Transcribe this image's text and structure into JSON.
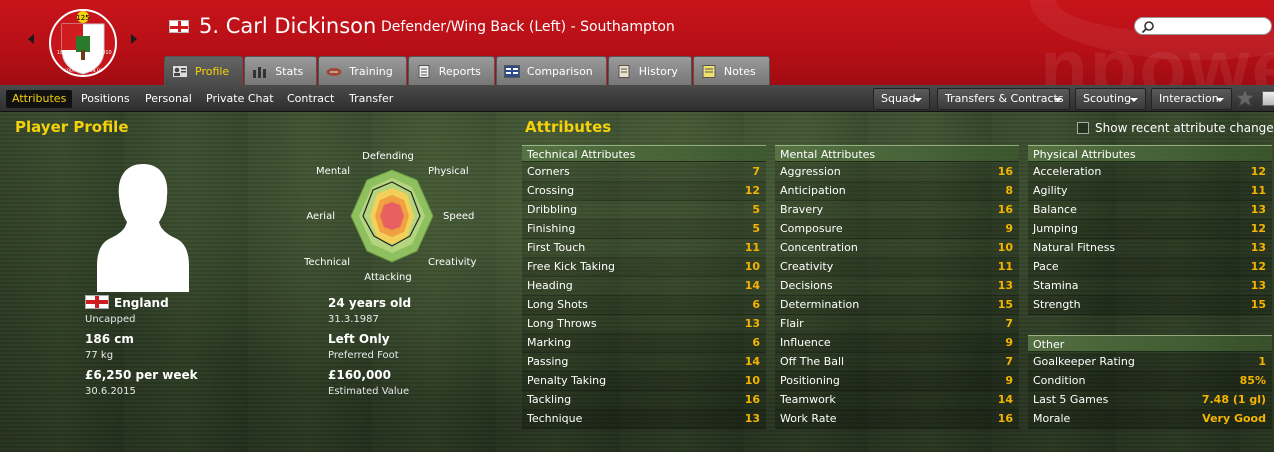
{
  "header": {
    "player_name": "5. Carl Dickinson",
    "player_desc": "Defender/Wing Back (Left) - Southampton",
    "crest_text": [
      "125",
      "1885",
      "2010",
      "SOUTHAMPTON FC"
    ],
    "bg_word": "npowe",
    "search_placeholder": ""
  },
  "tabs": [
    {
      "label": "Profile",
      "icon": "profile-icon",
      "active": true
    },
    {
      "label": "Stats",
      "icon": "stats-icon"
    },
    {
      "label": "Training",
      "icon": "training-icon"
    },
    {
      "label": "Reports",
      "icon": "reports-icon"
    },
    {
      "label": "Comparison",
      "icon": "comparison-icon"
    },
    {
      "label": "History",
      "icon": "history-icon"
    },
    {
      "label": "Notes",
      "icon": "notes-icon"
    }
  ],
  "subnav": {
    "items": [
      "Attributes",
      "Positions",
      "Personal",
      "Private Chat",
      "Contract",
      "Transfer"
    ],
    "active": "Attributes",
    "dropdowns": [
      "Squad",
      "Transfers & Contracts",
      "Scouting",
      "Interaction"
    ]
  },
  "profile": {
    "title": "Player Profile",
    "radar_labels": {
      "top": "Defending",
      "top_right": "Physical",
      "right": "Speed",
      "bottom_right": "Creativity",
      "bottom": "Attacking",
      "bottom_left": "Technical",
      "left": "Aerial",
      "top_left": "Mental"
    },
    "nationality": "England",
    "caps": "Uncapped",
    "height": "186 cm",
    "weight": "77 kg",
    "wage": "£6,250 per week",
    "contract_expiry": "30.6.2015",
    "age": "24 years old",
    "dob": "31.3.1987",
    "preferred_foot": "Left Only",
    "preferred_foot_label": "Preferred Foot",
    "value": "£160,000",
    "value_label": "Estimated Value"
  },
  "attributes": {
    "title": "Attributes",
    "toggle_label": "Show recent attribute changes",
    "technical": {
      "header": "Technical Attributes",
      "rows": [
        [
          "Corners",
          "7"
        ],
        [
          "Crossing",
          "12"
        ],
        [
          "Dribbling",
          "5"
        ],
        [
          "Finishing",
          "5"
        ],
        [
          "First Touch",
          "11"
        ],
        [
          "Free Kick Taking",
          "10"
        ],
        [
          "Heading",
          "14"
        ],
        [
          "Long Shots",
          "6"
        ],
        [
          "Long Throws",
          "13"
        ],
        [
          "Marking",
          "6"
        ],
        [
          "Passing",
          "14"
        ],
        [
          "Penalty Taking",
          "10"
        ],
        [
          "Tackling",
          "16"
        ],
        [
          "Technique",
          "13"
        ]
      ]
    },
    "mental": {
      "header": "Mental Attributes",
      "rows": [
        [
          "Aggression",
          "16"
        ],
        [
          "Anticipation",
          "8"
        ],
        [
          "Bravery",
          "16"
        ],
        [
          "Composure",
          "9"
        ],
        [
          "Concentration",
          "10"
        ],
        [
          "Creativity",
          "11"
        ],
        [
          "Decisions",
          "13"
        ],
        [
          "Determination",
          "15"
        ],
        [
          "Flair",
          "7"
        ],
        [
          "Influence",
          "9"
        ],
        [
          "Off The Ball",
          "7"
        ],
        [
          "Positioning",
          "9"
        ],
        [
          "Teamwork",
          "14"
        ],
        [
          "Work Rate",
          "16"
        ]
      ]
    },
    "physical": {
      "header": "Physical Attributes",
      "rows": [
        [
          "Acceleration",
          "12"
        ],
        [
          "Agility",
          "11"
        ],
        [
          "Balance",
          "13"
        ],
        [
          "Jumping",
          "12"
        ],
        [
          "Natural Fitness",
          "13"
        ],
        [
          "Pace",
          "12"
        ],
        [
          "Stamina",
          "13"
        ],
        [
          "Strength",
          "15"
        ]
      ]
    },
    "other": {
      "header": "Other",
      "rows": [
        [
          "Goalkeeper Rating",
          "1"
        ],
        [
          "Condition",
          "85%"
        ],
        [
          "Last 5 Games",
          "7.48 (1 gl)"
        ],
        [
          "Morale",
          "Very Good"
        ]
      ]
    }
  },
  "colors": {
    "accent": "#f4d20a",
    "header_red": "#c8141b",
    "value_orange": "#f4b400"
  }
}
